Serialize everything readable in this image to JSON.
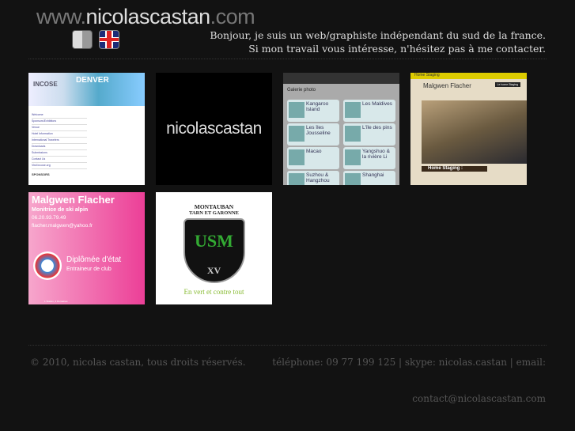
{
  "header": {
    "logo_prefix": "www.",
    "logo_name": "nicolascastan",
    "logo_suffix": ".com",
    "intro_line1": "Bonjour, je suis un web/graphiste indépendant du sud de la france.",
    "intro_line2": "Si mon travail vous intéresse, n'hésitez pas à me contacter.",
    "icons": [
      "thumbs-up-icon",
      "uk-flag-icon"
    ]
  },
  "portfolio": {
    "incose": {
      "logo": "INCOSE",
      "city": "DENVER",
      "menu": [
        "Welcome",
        "Sponsors/Exhibitors",
        "Venue",
        "Hotel Information",
        "International Travelers",
        "Downloads",
        "Submissions",
        "Contact Us",
        "Visit incose.org"
      ],
      "sponsors": "SPONSORS"
    },
    "nicolascastan": {
      "text": "nicolascastan"
    },
    "gallery": {
      "title": "Galerie photo",
      "items": [
        "Kangaroo Island",
        "Les Maldives",
        "Les îles Jousseline",
        "L'île des pins",
        "Macao",
        "Yangshuo & la rivière Li",
        "Suzhou & Hangzhou",
        "Shanghai"
      ]
    },
    "homestaging": {
      "top": "Home Staging",
      "name": "Malgwen Flacher",
      "nav": "Le home Staging",
      "section": "Home Staging :"
    },
    "ski": {
      "name": "Malgwen Flacher",
      "role": "Monitrice de ski alpin",
      "phone": "06.20.93.79.49",
      "email": "flacher.malgwen@yahoo.fr",
      "diploma": "Diplômée d'état",
      "sub": "Entraineur de club",
      "tagline": "1 Station, 3 Domaines"
    },
    "montauban": {
      "line1": "MONTAUBAN",
      "line2": "TARN ET GARONNE",
      "crest": "USM",
      "xv": "XV",
      "motto": "En vert et contre tout"
    }
  },
  "footer": {
    "copyright": "© 2010, nicolas castan, tous droits réservés.",
    "contact": "téléphone: 09 77 199 125 | skype: nicolas.castan | email:",
    "email": "contact@nicolascastan.com"
  }
}
